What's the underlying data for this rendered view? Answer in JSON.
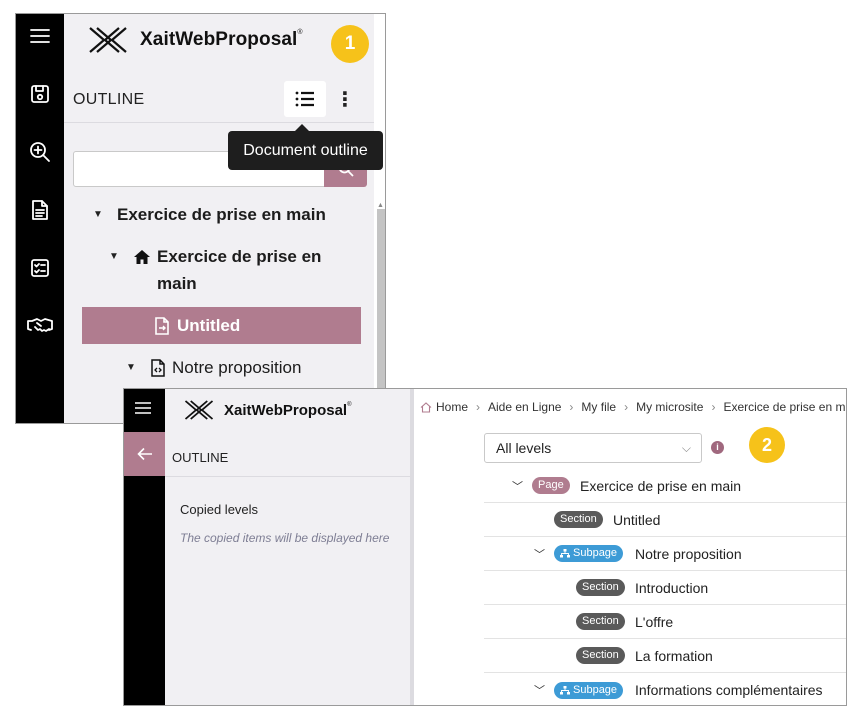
{
  "panel1": {
    "brand": "XaitWebProposal",
    "brand_mark": "®",
    "step_badge": "1",
    "outline_header": "OUTLINE",
    "tooltip": "Document outline",
    "search": {
      "placeholder": ""
    },
    "tree": [
      {
        "label": "Exercice de prise en main"
      },
      {
        "label_line1": "Exercice de prise en",
        "label_line2": "main"
      },
      {
        "label": "Untitled"
      },
      {
        "label": "Notre proposition"
      }
    ]
  },
  "panel2": {
    "brand": "XaitWebProposal",
    "brand_mark": "®",
    "step_badge": "2",
    "outline_header": "OUTLINE",
    "copied_title": "Copied levels",
    "copied_hint": "The copied items will be displayed here",
    "breadcrumb": [
      "Home",
      "Aide en Ligne",
      "My file",
      "My microsite",
      "Exercice de prise en main"
    ],
    "levels_select": "All levels",
    "info_glyph": "i",
    "rows": [
      {
        "tag": "Page",
        "label": "Exercice de prise en main"
      },
      {
        "tag": "Section",
        "label": "Untitled"
      },
      {
        "tag": "Subpage",
        "label": "Notre proposition"
      },
      {
        "tag": "Section",
        "label": "Introduction"
      },
      {
        "tag": "Section",
        "label": "L'offre"
      },
      {
        "tag": "Section",
        "label": "La formation"
      },
      {
        "tag": "Subpage",
        "label": "Informations complémentaires"
      }
    ]
  },
  "colors": {
    "accent": "#b07c8f",
    "badge": "#f6c21a",
    "subpage": "#3d9bd6",
    "section": "#5a5a5a"
  }
}
